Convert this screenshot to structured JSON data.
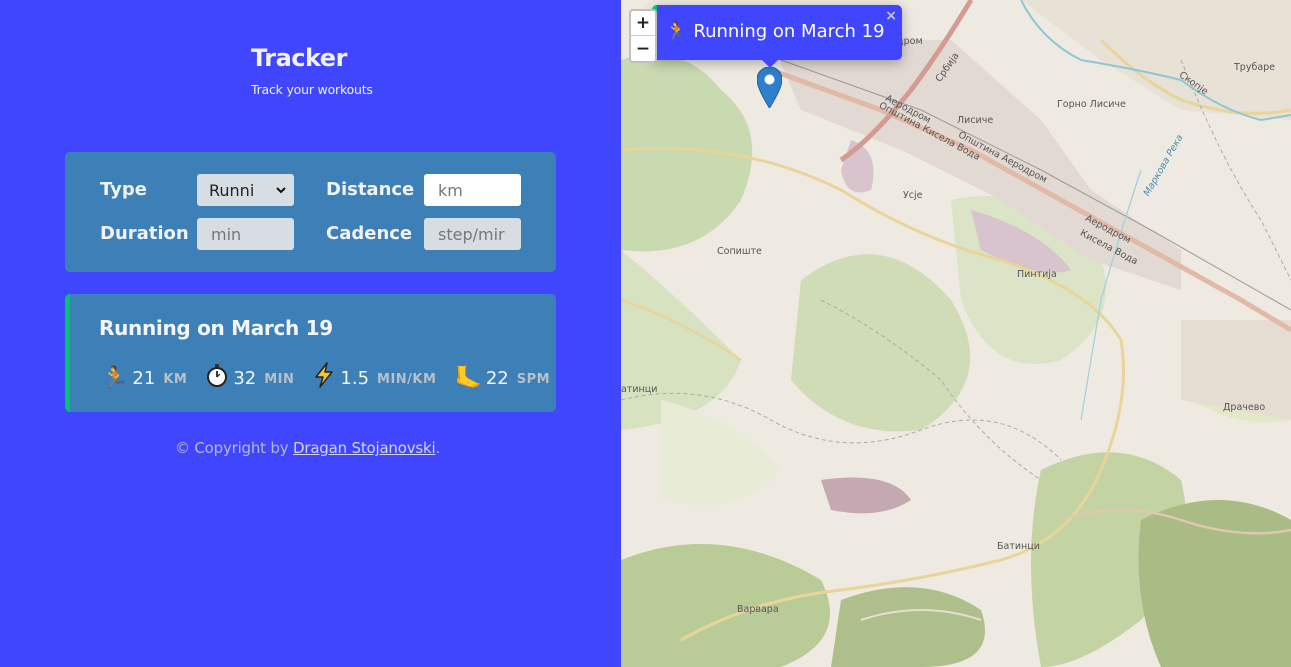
{
  "brand": {
    "title": "Tracker",
    "subtitle": "Track your workouts"
  },
  "form": {
    "type_label": "Type",
    "type_value": "Runni",
    "distance_label": "Distance",
    "distance_placeholder": "km",
    "duration_label": "Duration",
    "duration_placeholder": "min",
    "cadence_label": "Cadence",
    "cadence_placeholder": "step/mir"
  },
  "workout": {
    "title": "Running on March 19",
    "details": [
      {
        "icon": "runner-icon",
        "glyph": "🏃",
        "value": "21",
        "unit": "KM"
      },
      {
        "icon": "stopwatch-icon",
        "glyph": "⏱",
        "value": "32",
        "unit": "MIN"
      },
      {
        "icon": "lightning-icon",
        "glyph": "⚡",
        "value": "1.5",
        "unit": "MIN/KM"
      },
      {
        "icon": "foot-icon",
        "glyph": "🦶",
        "value": "22",
        "unit": "SPM"
      }
    ]
  },
  "copyright": {
    "prefix": "© Copyright by ",
    "author": "Dragan Stojanovski",
    "suffix": "."
  },
  "map": {
    "zoom_in": "+",
    "zoom_out": "−",
    "popup_text": "Running on March 19",
    "popup_glyph": "🏃",
    "popup_close": "×",
    "labels": {
      "srbija": "Србија",
      "aerodrom1": "Аеродром",
      "opstina_kisela": "Општина Кисела Вода",
      "lisice": "Лисиче",
      "gorno_lisice": "Горно Лисиче",
      "opstina_aerodrom": "Општина Аеродром",
      "skopje": "Скопје",
      "trubarevo": "Трубаре",
      "markova": "Маркова Река",
      "usje": "Усје",
      "aerodrom2": "Аеродром",
      "kisela": "Кисела Вода",
      "sopiste": "Сопиште",
      "pintija": "Пинтија",
      "dracevo": "Драчево",
      "batinci": "Батинци",
      "batinci_left": "атинци",
      "varvara": "Варвара",
      "rdrom": "рдром"
    }
  },
  "colors": {
    "sidebar_bg": "#4046fd",
    "card_bg": "#3d80b8",
    "running_accent": "#00c46a"
  }
}
